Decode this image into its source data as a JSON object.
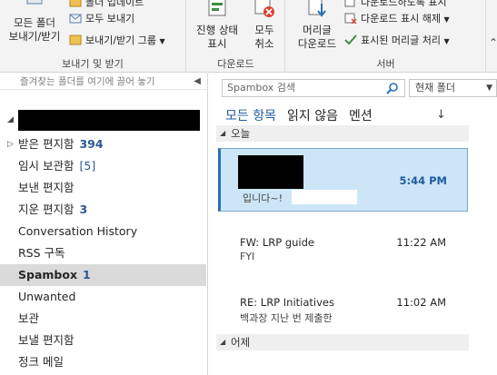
{
  "ribbon": {
    "groups": [
      {
        "label": "보내기 및 받기"
      },
      {
        "label": "다운로드"
      },
      {
        "label": "서버"
      }
    ],
    "send_all_line1": "모든 폴더",
    "send_all_line2": "보내기/받기",
    "update_folder": "폴더 업데이트",
    "send_all": "모두 보내기",
    "send_receive_groups": "보내기/받기 그룹",
    "show_progress_line1": "진행 상태",
    "show_progress_line2": "표시",
    "cancel_all_line1": "모두",
    "cancel_all_line2": "취소",
    "download_headers_line1": "머리글",
    "download_headers_line2": "다운로드",
    "download_headers_top": "다운로드하도록 표시",
    "unmark_download": "다운로드 표시 해제",
    "process_marked_headers": "표시된 머리글 처리"
  },
  "folders": {
    "favorites_hint": "즐겨찾는 폴더를 여기에 끌어 놓기",
    "items": [
      {
        "name": "받은 편지함",
        "count": "394",
        "style": "bold"
      },
      {
        "name": "임시 보관함",
        "count": "[5]",
        "style": "plain"
      },
      {
        "name": "보낸 편지함",
        "count": "",
        "style": "plain"
      },
      {
        "name": "지운 편지함",
        "count": "3",
        "style": "bold"
      },
      {
        "name": "Conversation History",
        "count": "",
        "style": "plain"
      },
      {
        "name": "RSS 구독",
        "count": "",
        "style": "plain"
      },
      {
        "name": "Spambox",
        "count": "1",
        "style": "bold"
      },
      {
        "name": "Unwanted",
        "count": "",
        "style": "plain"
      },
      {
        "name": "보관",
        "count": "",
        "style": "plain"
      },
      {
        "name": "보낼 편지함",
        "count": "",
        "style": "plain"
      },
      {
        "name": "정크 메일",
        "count": "",
        "style": "plain"
      }
    ]
  },
  "list": {
    "search_placeholder": "Spambox 검색",
    "scope": "현재 폴더",
    "filters": [
      "모든 항목",
      "읽지 않음",
      "멘션"
    ],
    "groups": [
      "오늘",
      "어제"
    ],
    "messages": [
      {
        "sender": "",
        "time": "5:44 PM",
        "subject": "입니다~!"
      },
      {
        "sender": "FW: LRP guide",
        "time": "11:22 AM",
        "subject": "FYI"
      },
      {
        "sender": "RE: LRP Initiatives",
        "time": "11:02 AM",
        "subject": "백과장   지난 번 제출한"
      }
    ]
  },
  "colors": {
    "accent": "#1f5aa0",
    "selected_bg": "#cde6f7"
  }
}
